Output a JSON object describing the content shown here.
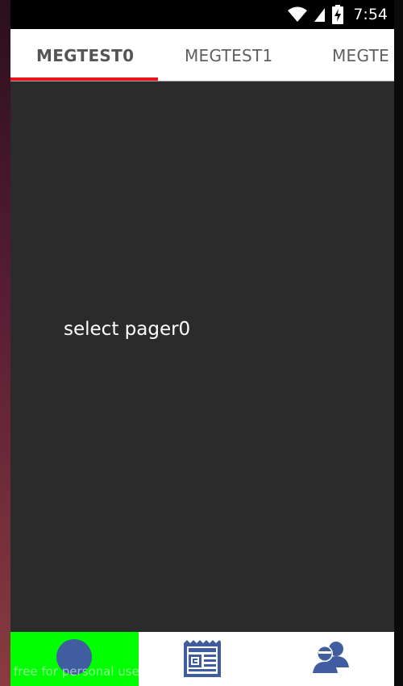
{
  "status_bar": {
    "time": "7:54",
    "icons": [
      "wifi-icon",
      "signal-icon",
      "battery-charging-icon"
    ]
  },
  "tabs": [
    {
      "label": "MEGTEST0",
      "selected": true
    },
    {
      "label": "MEGTEST1",
      "selected": false
    },
    {
      "label": "MEGTE",
      "selected": false
    }
  ],
  "content": {
    "text": "select pager0"
  },
  "bottom_nav": {
    "items": [
      {
        "icon": "circle-icon",
        "selected": true
      },
      {
        "icon": "newspaper-icon",
        "selected": false
      },
      {
        "icon": "users-icon",
        "selected": false
      }
    ],
    "watermark": "free for personal use"
  },
  "colors": {
    "tab_indicator": "#e8131b",
    "content_bg": "#2b2b2b",
    "nav_selected_bg": "#00ff00",
    "icon_blue": "#3f5d9f"
  }
}
